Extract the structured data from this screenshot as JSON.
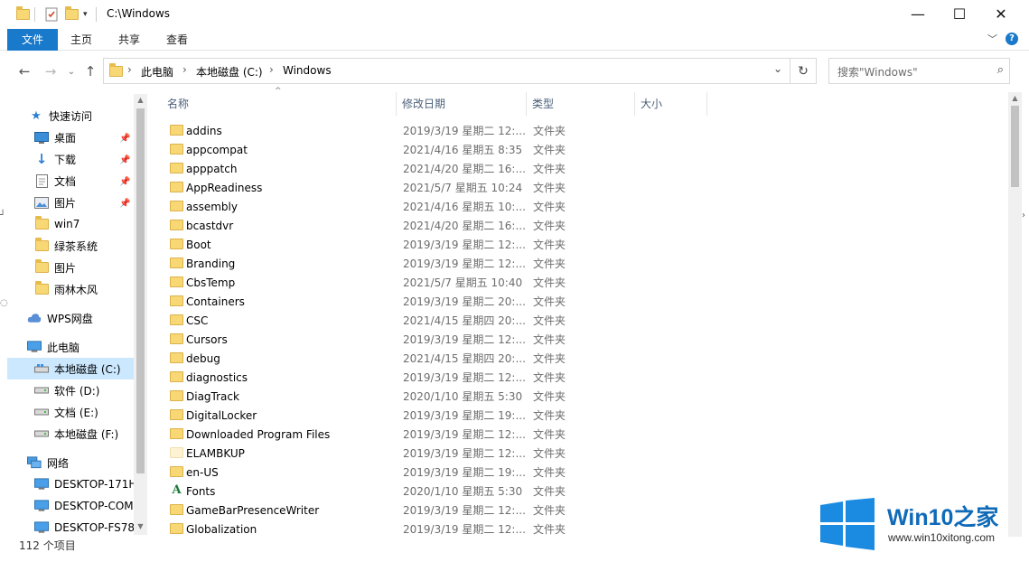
{
  "window": {
    "title": "C:\\Windows",
    "minimize": "—",
    "maximize": "☐",
    "close": "✕"
  },
  "ribbon": {
    "tabs": [
      "文件",
      "主页",
      "共享",
      "查看"
    ],
    "expand_icon": "﹀",
    "help_icon": "?"
  },
  "address": {
    "back": "←",
    "forward": "→",
    "recent": "⌄",
    "up": "↑",
    "path": [
      "此电脑",
      "本地磁盘 (C:)",
      "Windows"
    ],
    "dropdown": "⌄",
    "refresh": "↻"
  },
  "search": {
    "placeholder": "搜索\"Windows\"",
    "icon": "⌕"
  },
  "nav": {
    "quick_access": "快速访问",
    "pinned": [
      {
        "label": "桌面",
        "icon": "desktop-icon"
      },
      {
        "label": "下载",
        "icon": "download-icon"
      },
      {
        "label": "文档",
        "icon": "document-icon"
      },
      {
        "label": "图片",
        "icon": "picture-icon"
      }
    ],
    "folders": [
      "win7",
      "绿茶系统",
      "图片",
      "雨林木风"
    ],
    "wps": "WPS网盘",
    "this_pc": "此电脑",
    "drives": [
      "本地磁盘 (C:)",
      "软件 (D:)",
      "文档 (E:)",
      "本地磁盘 (F:)"
    ],
    "network": "网络",
    "computers": [
      "DESKTOP-171H",
      "DESKTOP-COM",
      "DESKTOP-FS78"
    ]
  },
  "columns": {
    "name": "名称",
    "modified": "修改日期",
    "type": "类型",
    "size": "大小"
  },
  "files": [
    {
      "name": "addins",
      "date": "2019/3/19 星期二 12:...",
      "type": "文件夹",
      "icon": "folder"
    },
    {
      "name": "appcompat",
      "date": "2021/4/16 星期五 8:35",
      "type": "文件夹",
      "icon": "folder"
    },
    {
      "name": "apppatch",
      "date": "2021/4/20 星期二 16:...",
      "type": "文件夹",
      "icon": "folder"
    },
    {
      "name": "AppReadiness",
      "date": "2021/5/7 星期五 10:24",
      "type": "文件夹",
      "icon": "folder"
    },
    {
      "name": "assembly",
      "date": "2021/4/16 星期五 10:...",
      "type": "文件夹",
      "icon": "folder"
    },
    {
      "name": "bcastdvr",
      "date": "2021/4/20 星期二 16:...",
      "type": "文件夹",
      "icon": "folder"
    },
    {
      "name": "Boot",
      "date": "2019/3/19 星期二 12:...",
      "type": "文件夹",
      "icon": "folder"
    },
    {
      "name": "Branding",
      "date": "2019/3/19 星期二 12:...",
      "type": "文件夹",
      "icon": "folder"
    },
    {
      "name": "CbsTemp",
      "date": "2021/5/7 星期五 10:40",
      "type": "文件夹",
      "icon": "folder"
    },
    {
      "name": "Containers",
      "date": "2019/3/19 星期二 20:...",
      "type": "文件夹",
      "icon": "folder"
    },
    {
      "name": "CSC",
      "date": "2021/4/15 星期四 20:...",
      "type": "文件夹",
      "icon": "folder"
    },
    {
      "name": "Cursors",
      "date": "2019/3/19 星期二 12:...",
      "type": "文件夹",
      "icon": "folder"
    },
    {
      "name": "debug",
      "date": "2021/4/15 星期四 20:...",
      "type": "文件夹",
      "icon": "folder"
    },
    {
      "name": "diagnostics",
      "date": "2019/3/19 星期二 12:...",
      "type": "文件夹",
      "icon": "folder"
    },
    {
      "name": "DiagTrack",
      "date": "2020/1/10 星期五 5:30",
      "type": "文件夹",
      "icon": "folder"
    },
    {
      "name": "DigitalLocker",
      "date": "2019/3/19 星期二 19:...",
      "type": "文件夹",
      "icon": "folder"
    },
    {
      "name": "Downloaded Program Files",
      "date": "2019/3/19 星期二 12:...",
      "type": "文件夹",
      "icon": "folder"
    },
    {
      "name": "ELAMBKUP",
      "date": "2019/3/19 星期二 12:...",
      "type": "文件夹",
      "icon": "folder-light"
    },
    {
      "name": "en-US",
      "date": "2019/3/19 星期二 19:...",
      "type": "文件夹",
      "icon": "folder"
    },
    {
      "name": "Fonts",
      "date": "2020/1/10 星期五 5:30",
      "type": "文件夹",
      "icon": "font",
      "glyph": "A"
    },
    {
      "name": "GameBarPresenceWriter",
      "date": "2019/3/19 星期二 12:...",
      "type": "文件夹",
      "icon": "folder"
    },
    {
      "name": "Globalization",
      "date": "2019/3/19 星期二 12:...",
      "type": "文件夹",
      "icon": "folder"
    }
  ],
  "status": {
    "count": "112 个项目"
  },
  "watermark": {
    "title": "Win10之家",
    "url": "www.win10xitong.com"
  },
  "colors": {
    "accent": "#1979ca",
    "selection": "#cce8ff",
    "folder": "#f8d775",
    "header_text": "#4c607a",
    "watermark_blue": "#0f6ab8"
  }
}
